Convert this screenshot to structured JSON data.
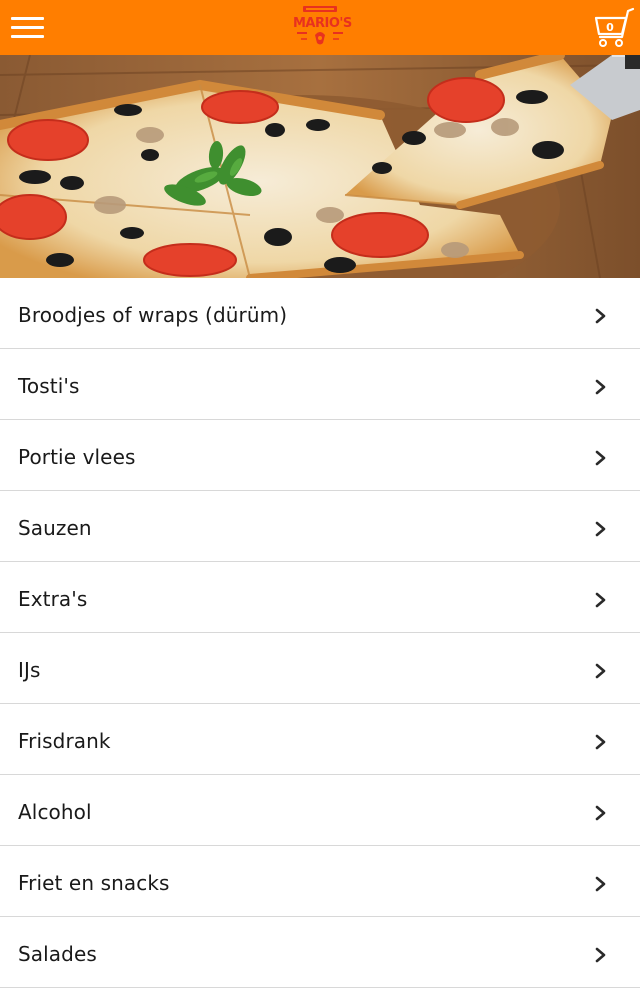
{
  "header": {
    "menu_icon": "hamburger-menu-icon",
    "logo_text": "MARIO'S",
    "cart_icon": "shopping-cart-icon",
    "cart_count": "0",
    "brand_color": "#ff7e00",
    "logo_color": "#e8311f"
  },
  "hero": {
    "image": "pizza-photo"
  },
  "categories": [
    {
      "label": "Broodjes of wraps (dürüm)",
      "icon": "chevron-right-icon"
    },
    {
      "label": "Tosti's",
      "icon": "chevron-right-icon"
    },
    {
      "label": "Portie vlees",
      "icon": "chevron-right-icon"
    },
    {
      "label": "Sauzen",
      "icon": "chevron-right-icon"
    },
    {
      "label": "Extra's",
      "icon": "chevron-right-icon"
    },
    {
      "label": "IJs",
      "icon": "chevron-right-icon"
    },
    {
      "label": "Frisdrank",
      "icon": "chevron-right-icon"
    },
    {
      "label": "Alcohol",
      "icon": "chevron-right-icon"
    },
    {
      "label": "Friet en snacks",
      "icon": "chevron-right-icon"
    },
    {
      "label": "Salades",
      "icon": "chevron-right-icon"
    }
  ]
}
